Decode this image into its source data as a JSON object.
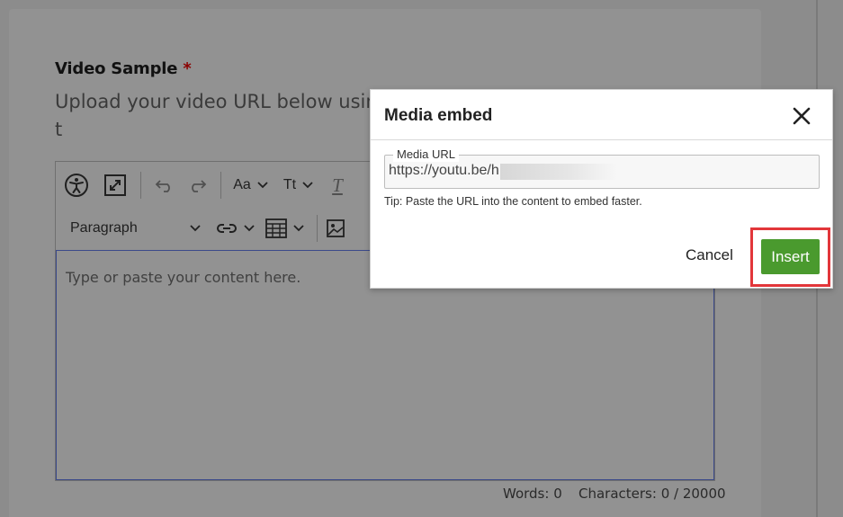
{
  "form": {
    "field_label": "Video Sample",
    "required_mark": "*",
    "help_text": "Upload your video URL below using t\nis set so anyone with access can view"
  },
  "editor": {
    "block_format": "Paragraph",
    "font_family_label": "Aa",
    "font_size_label": "Tt",
    "clear_format_label": "T",
    "placeholder": "Type or paste your content here.",
    "words": "Words: 0",
    "characters": "Characters: 0 / 20000"
  },
  "modal": {
    "title": "Media embed",
    "url_label": "Media URL",
    "url_value": "https://youtu.be/h",
    "tip": "Tip: Paste the URL into the content to embed faster.",
    "cancel_label": "Cancel",
    "insert_label": "Insert"
  },
  "colors": {
    "insert_button": "#4a9a2e",
    "highlight_box": "#e2363a",
    "overlay_background": "#8c8c8c"
  },
  "icons": [
    "accessibility-icon",
    "fullscreen-icon",
    "undo-icon",
    "redo-icon",
    "chevron-down-icon",
    "link-icon",
    "table-icon",
    "image-icon",
    "close-icon"
  ]
}
